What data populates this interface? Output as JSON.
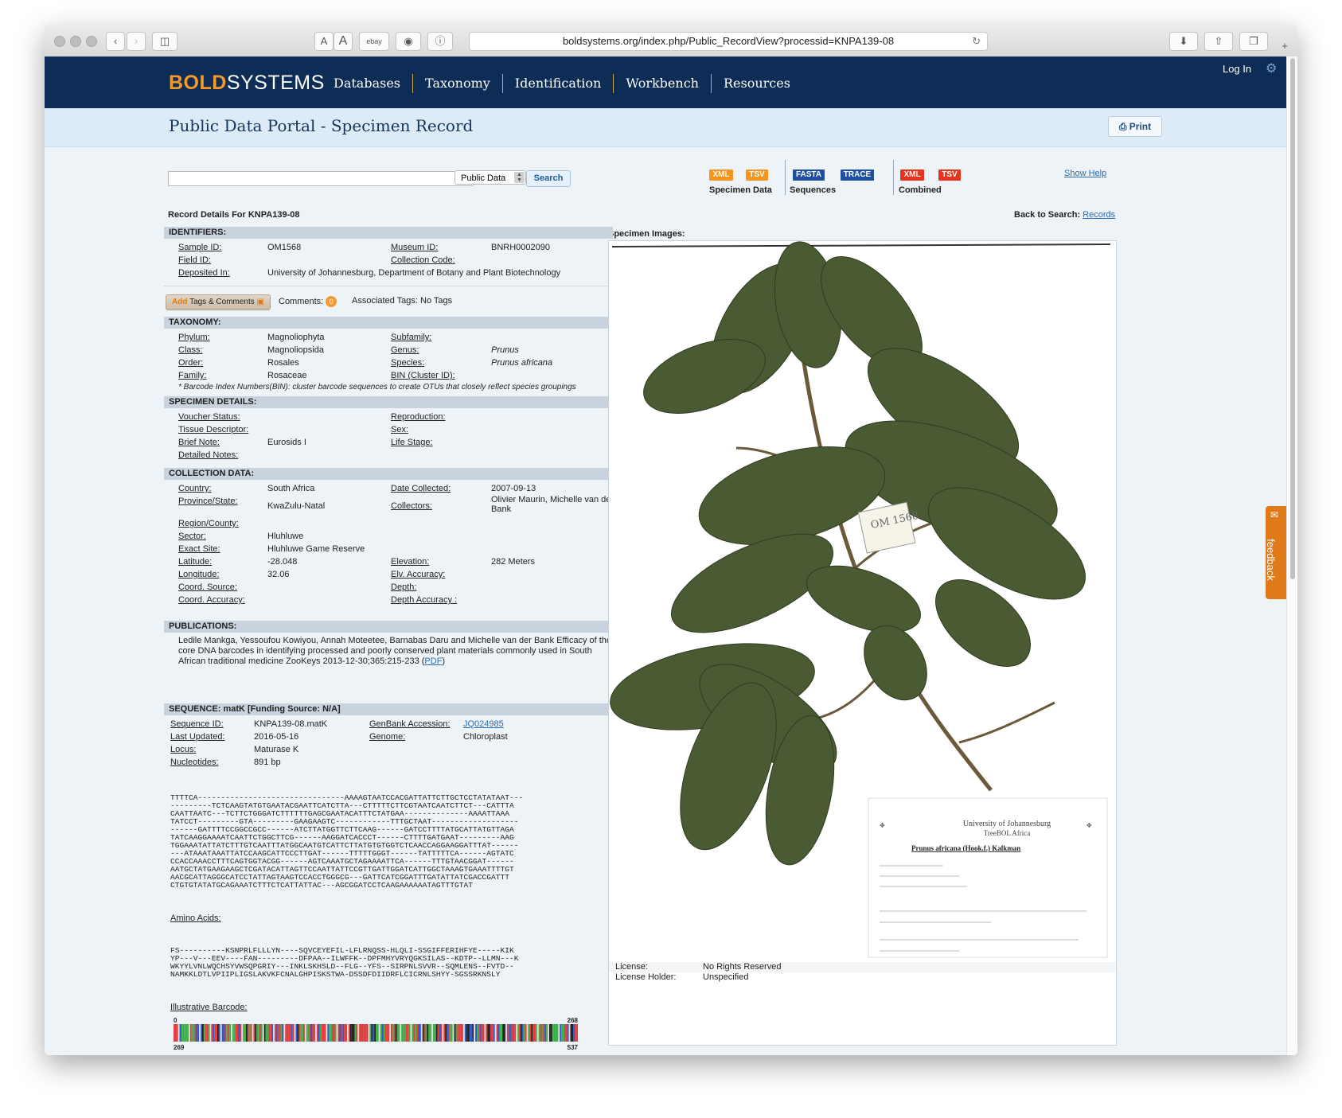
{
  "browser": {
    "url": "boldsystems.org/index.php/Public_RecordView?processid=KNPA139-08",
    "font_small": "A",
    "font_large": "A",
    "bookmark": "ebay"
  },
  "header": {
    "logo_bold": "BOLD",
    "logo_systems": "SYSTEMS",
    "nav": [
      "Databases",
      "Taxonomy",
      "Identification",
      "Workbench",
      "Resources"
    ],
    "login": "Log In"
  },
  "page": {
    "title": "Public Data Portal - Specimen Record",
    "print": "Print"
  },
  "search": {
    "scope": "Public Data",
    "button": "Search"
  },
  "downloads": {
    "xml": "XML",
    "tsv": "TSV",
    "fasta": "FASTA",
    "trace": "TRACE",
    "specimen_data": "Specimen Data",
    "sequences": "Sequences",
    "combined": "Combined",
    "show_help": "Show Help"
  },
  "record": {
    "details_label": "Record Details For KNPA139-08",
    "back_label": "Back to Search:",
    "back_link": "Records",
    "specimen_images": "Specimen Images:"
  },
  "identifiers": {
    "title": "IDENTIFIERS:",
    "rows": [
      [
        "Sample ID:",
        "OM1568",
        "Museum ID:",
        "BNRH0002090"
      ],
      [
        "Field ID:",
        "",
        "Collection Code:",
        ""
      ],
      [
        "Deposited In:",
        "University of Johannesburg, Department of Botany and Plant Biotechnology",
        "",
        ""
      ]
    ]
  },
  "tags": {
    "button_add": "Add",
    "button_rest": "Tags & Comments",
    "comments_label": "Comments:",
    "comments_count": "0",
    "assoc": "Associated Tags: No Tags"
  },
  "taxonomy": {
    "title": "TAXONOMY:",
    "rows": [
      [
        "Phylum:",
        "Magnoliophyta",
        "Subfamily:",
        ""
      ],
      [
        "Class:",
        "Magnoliopsida",
        "Genus:",
        "Prunus"
      ],
      [
        "Order:",
        "Rosales",
        "Species:",
        "Prunus africana"
      ],
      [
        "Family:",
        "Rosaceae",
        "BIN (Cluster ID):",
        ""
      ]
    ],
    "note": "* Barcode Index Numbers(BIN): cluster barcode sequences to create OTUs that closely reflect species groupings"
  },
  "specimen": {
    "title": "SPECIMEN DETAILS:",
    "rows": [
      [
        "Voucher Status:",
        "",
        "Reproduction:",
        ""
      ],
      [
        "Tissue Descriptor:",
        "",
        "Sex:",
        ""
      ],
      [
        "Brief Note:",
        "Eurosids I",
        "Life Stage:",
        ""
      ],
      [
        "Detailed Notes:",
        "",
        "",
        ""
      ]
    ]
  },
  "collection": {
    "title": "COLLECTION DATA:",
    "rows": [
      [
        "Country:",
        "South Africa",
        "Date Collected:",
        "2007-09-13"
      ],
      [
        "Province/State:",
        "KwaZulu-Natal",
        "Collectors:",
        "Olivier Maurin, Michelle van der Bank"
      ],
      [
        "Region/County:",
        "",
        "",
        ""
      ],
      [
        "Sector:",
        "Hluhluwe",
        "",
        ""
      ],
      [
        "Exact Site:",
        "Hluhluwe Game Reserve",
        "",
        ""
      ],
      [
        "Latitude:",
        "-28.048",
        "Elevation:",
        "282 Meters"
      ],
      [
        "Longitude:",
        "32.06",
        "Elv. Accuracy:",
        ""
      ],
      [
        "Coord. Source:",
        "",
        "Depth:",
        ""
      ],
      [
        "Coord. Accuracy:",
        "",
        "Depth Accuracy :",
        ""
      ]
    ]
  },
  "publications": {
    "title": "PUBLICATIONS:",
    "text": "Ledile Mankga, Yessoufou Kowiyou, Annah Moteetee, Barnabas Daru and Michelle van der Bank Efficacy of the core DNA barcodes in identifying processed and poorly conserved plant materials commonly used in South African traditional medicine ZooKeys 2013-12-30;365:215-233 (",
    "pdf": "PDF",
    "tail": ")"
  },
  "sequence": {
    "title": "SEQUENCE: matK   [Funding Source: N/A]",
    "rows": [
      [
        "Sequence ID:",
        "KNPA139-08.matK",
        "GenBank Accession:",
        "JQ024985"
      ],
      [
        "Last Updated:",
        "2016-05-16",
        "Genome:",
        "Chloroplast"
      ],
      [
        "Locus:",
        "Maturase K",
        "",
        ""
      ],
      [
        "Nucleotides:",
        "891 bp",
        "",
        ""
      ]
    ],
    "nucleotides": [
      "TTTTCA--------------------------------AAAAGTAATCCACGATTATTCTTGCTCCTATATAAT---",
      "---------TCTCAAGTATGTGAATACGAATTCATCTTA---CTTTTTCTTCGTAATCAATCTTCT---CATTTA",
      "CAATTAATC---TCTTCTGGGATCTTTTTTGAGCGAATACATTTCTATGAA--------------AAAATTAAA",
      "TATCCT---------GTA---------GAAGAAGTC------------TTTGCTAAT-------------------",
      "------GATTTTCCGGCCGCC------ATCTTATGGTTCTTCAAG------GATCCTTTTATGCATTATGTTAGA",
      "TATCAAGGAAAATCAATTCTGGCTTCG------AAGGATCACCCT------CTTTTGATGAAT---------AAG",
      "TGGAAATATTATCTTTGTCAATTTATGGCAATGTCATTCTTATGTGTGGTCTCAACCAGGAAGGATTTAT------",
      "---ATAAATAAATTATCCAAGCATTCCCTTGAT------TTTTTGGGT------TATTTTTCA------AGTATC",
      "CCACCAAACCTTTCAGTGGTACGG------AGTCAAATGCTAGAAAATTCA------TTTGTAACGGAT------",
      "AATGCTATGAAGAAGCTCGATACATTAGTTCCAATTATTCCGTTGATTGGATCATTGGCTAAAGTGAAATTTTGT",
      "AACGCATTAGGGCATCCTATTAGTAAGTCCACCTGGGCG---GATTCATCGGATTTGATATTATCGACCGATTT",
      "CTGTGTATATGCAGAAATCTTTCTCATTATTAC---AGCGGATCCTCAAGAAAAAATAGTTTGTAT"
    ],
    "amino_label": "Amino Acids:",
    "amino": [
      "FS----------KSNPRLFLLLYN----SQVCEYEFIL-LFLRNQSS-HLQLI-SSGIFFERIHFYE-----KIK",
      "YP---V---EEV----FAN---------DFPAA--ILWFFK--DPFMHYVRYQGKSILAS--KDTP--LLMN---K",
      "WKYYLVNLWQCHSYVWSQPGRIY---INKLSKHSLD--FLG--YFS--SIRPNLSVVR--SQMLENS--FVTD--",
      "NAMKKLDTLVPIIPLIGSLAKVKFCNALGHPISKSTWA-DSSDFDIIDRFLCICRNLSHYY-SGSSRKNSLY"
    ],
    "barcode_label": "Illustrative Barcode:",
    "barcode_start": "0",
    "barcode_end": "268",
    "barcode_start2": "269",
    "barcode_end2": "537"
  },
  "image": {
    "sheet_header": "University of Johannesburg",
    "sheet_sub": "TreeBOL Africa",
    "sheet_name": "Prunus africana (Hook.f.) Kalkman",
    "tag_text": "OM 1568",
    "license_label": "License:",
    "license": "No Rights Reserved",
    "holder_label": "License Holder:",
    "holder": "Unspecified"
  },
  "feedback": "feedback",
  "colors": {
    "header": "#0d2d57",
    "accent": "#f39a2b",
    "xml": "#f7941d",
    "fasta": "#1f4fa3",
    "combined": "#e8331c"
  }
}
